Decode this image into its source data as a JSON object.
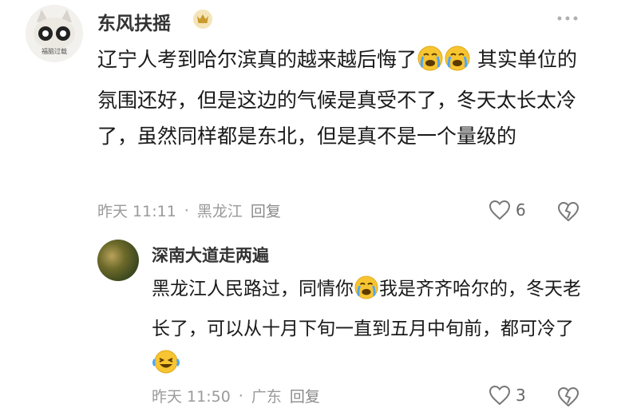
{
  "comment": {
    "username": "东风扶摇",
    "avatar_text": "福脑过载",
    "badge_icon": "crown-badge-icon",
    "more_icon": "more-dots-icon",
    "content": {
      "line_a": "辽宁人考到哈尔滨真的越来越后悔了",
      "line_b": "其实单位的氛围还好，但是这边的气候是真受不了，冬天太长太冷了，虽然同样都是东北，但是真不是一个量级的"
    },
    "emojis": [
      "crying-face-emoji",
      "crying-face-emoji"
    ],
    "time": "昨天 11:11",
    "separator": "·",
    "location": "黑龙江",
    "reply_label": "回复",
    "likes": "6"
  },
  "reply": {
    "username": "深南大道走两遍",
    "content": {
      "part_a": "黑龙江人民路过，同情你",
      "part_b": "我是齐齐哈尔的，冬天老长了，可以从十月下旬一直到五月中旬前，都可冷了"
    },
    "emojis": [
      "crying-face-emoji",
      "laughing-tears-emoji"
    ],
    "time": "昨天 11:50",
    "separator": "·",
    "location": "广东",
    "reply_label": "回复",
    "likes": "3"
  },
  "colors": {
    "text": "#1a1a1a",
    "meta": "#9a9a9a",
    "emoji": "#f7c531"
  }
}
